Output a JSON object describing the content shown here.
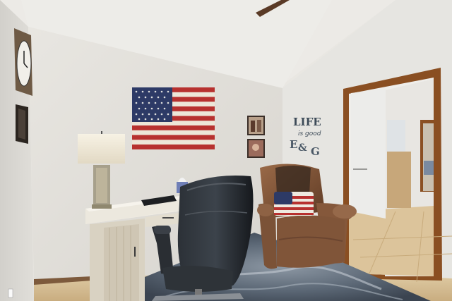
{
  "scene": {
    "type": "interior-photo",
    "room": "home office with recliner and American flag wall art"
  },
  "wall_decor": {
    "sign_word": "LIFE",
    "sign_script": "is good",
    "letter_1": "E",
    "letter_2": "&",
    "letter_3": "G"
  },
  "colors": {
    "wall": "#e4e2dc",
    "ceiling": "#ecebe7",
    "trim": "#8a4f22",
    "floor_tile": "#d9c39b",
    "rug": "#4f5c6b",
    "desk": "#e9e4d8",
    "chair": "#1f2328",
    "recliner": "#7b5237",
    "flag_red": "#b7312f",
    "flag_blue": "#2d3a66"
  },
  "icons": [
    "wall-clock-icon",
    "flag-icon",
    "lamp-icon",
    "chair-icon",
    "recliner-icon"
  ]
}
